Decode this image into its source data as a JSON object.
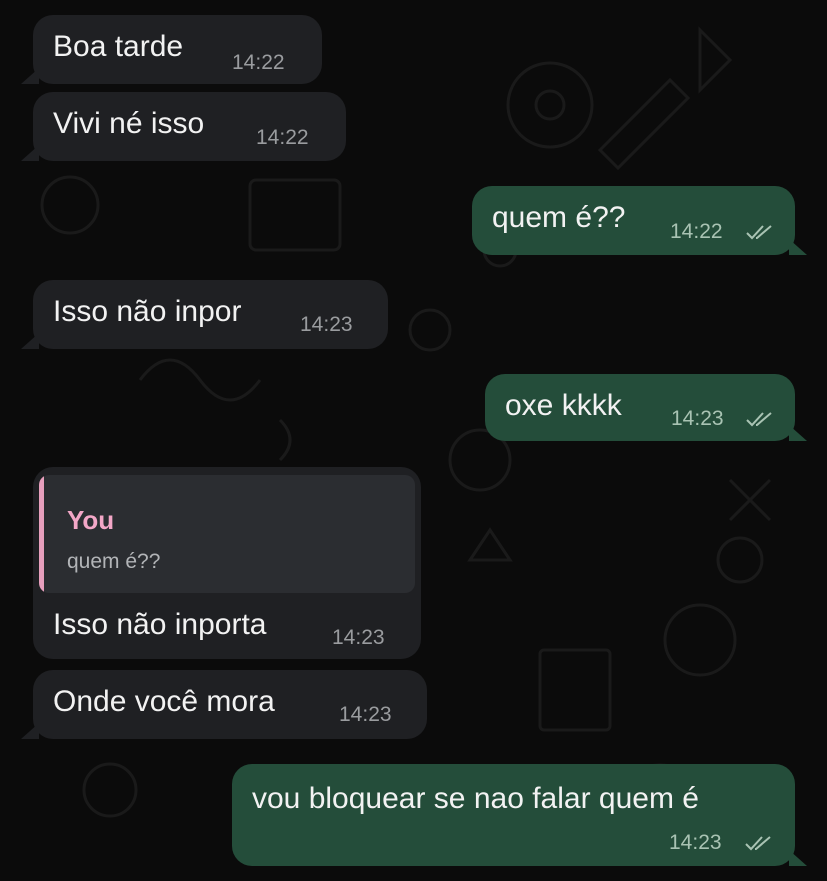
{
  "chat": {
    "messages": [
      {
        "direction": "incoming",
        "text": "Boa tarde",
        "time": "14:22"
      },
      {
        "direction": "incoming",
        "text": "Vivi né isso",
        "time": "14:22"
      },
      {
        "direction": "outgoing",
        "text": "quem é??",
        "time": "14:22",
        "status": "read-double-check-icon"
      },
      {
        "direction": "incoming",
        "text": "Isso não inpor",
        "time": "14:23"
      },
      {
        "direction": "outgoing",
        "text": "oxe kkkk",
        "time": "14:23",
        "status": "read-double-check-icon"
      },
      {
        "direction": "incoming",
        "reply_to": {
          "author": "You",
          "text": "quem é??"
        },
        "text": "Isso não inporta",
        "time": "14:23"
      },
      {
        "direction": "incoming",
        "text": "Onde você mora",
        "time": "14:23"
      },
      {
        "direction": "outgoing",
        "text": "vou bloquear se nao falar quem é",
        "time": "14:23",
        "status": "read-double-check-icon"
      }
    ]
  },
  "theme": {
    "background": "#0b0b0b",
    "incoming_bubble": "#1f2023",
    "outgoing_bubble": "#244d3a",
    "quote_accent": "#e79fbd"
  }
}
